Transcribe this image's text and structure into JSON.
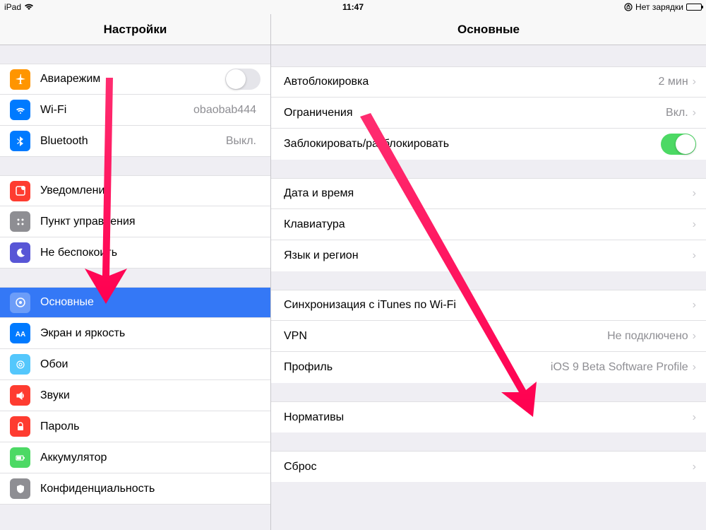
{
  "statusbar": {
    "device": "iPad",
    "time": "11:47",
    "charging_text": "Нет зарядки"
  },
  "sidebar": {
    "title": "Настройки",
    "groups": [
      {
        "items": [
          {
            "id": "airplane",
            "label": "Авиарежим",
            "value": "",
            "toggle": false,
            "toggle_on": false
          },
          {
            "id": "wifi",
            "label": "Wi-Fi",
            "value": "obaobab444"
          },
          {
            "id": "bluetooth",
            "label": "Bluetooth",
            "value": "Выкл."
          }
        ]
      },
      {
        "items": [
          {
            "id": "notifications",
            "label": "Уведомления"
          },
          {
            "id": "control_center",
            "label": "Пункт управления"
          },
          {
            "id": "dnd",
            "label": "Не беспокоить"
          }
        ]
      },
      {
        "items": [
          {
            "id": "general",
            "label": "Основные",
            "selected": true
          },
          {
            "id": "display",
            "label": "Экран и яркость"
          },
          {
            "id": "wallpaper",
            "label": "Обои"
          },
          {
            "id": "sounds",
            "label": "Звуки"
          },
          {
            "id": "passcode",
            "label": "Пароль"
          },
          {
            "id": "battery",
            "label": "Аккумулятор"
          },
          {
            "id": "privacy",
            "label": "Конфиденциальность"
          }
        ]
      }
    ]
  },
  "detail": {
    "title": "Основные",
    "groups": [
      {
        "items": [
          {
            "id": "autolock",
            "label": "Автоблокировка",
            "value": "2 мин",
            "chevron": true
          },
          {
            "id": "restrictions",
            "label": "Ограничения",
            "value": "Вкл.",
            "chevron": true
          },
          {
            "id": "lock_unlock",
            "label": "Заблокировать/разблокировать",
            "toggle": true,
            "toggle_on": true
          }
        ]
      },
      {
        "items": [
          {
            "id": "date_time",
            "label": "Дата и время",
            "chevron": true
          },
          {
            "id": "keyboard",
            "label": "Клавиатура",
            "chevron": true
          },
          {
            "id": "language",
            "label": "Язык и регион",
            "chevron": true
          }
        ]
      },
      {
        "items": [
          {
            "id": "itunes_sync",
            "label": "Синхронизация с iTunes по Wi-Fi",
            "chevron": true
          },
          {
            "id": "vpn",
            "label": "VPN",
            "value": "Не подключено",
            "chevron": true
          },
          {
            "id": "profile",
            "label": "Профиль",
            "value": "iOS 9 Beta Software Profile",
            "chevron": true
          }
        ]
      },
      {
        "items": [
          {
            "id": "regulatory",
            "label": "Нормативы",
            "chevron": true
          }
        ]
      },
      {
        "items": [
          {
            "id": "reset",
            "label": "Сброс",
            "chevron": true
          }
        ]
      }
    ]
  }
}
